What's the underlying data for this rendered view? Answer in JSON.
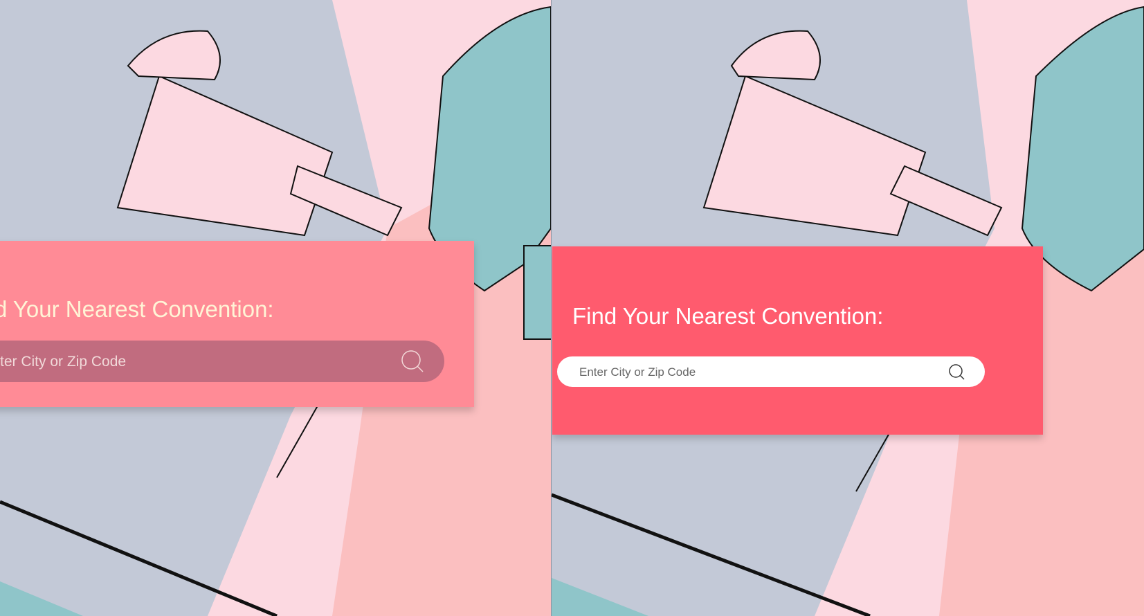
{
  "left_panel": {
    "title": "d Your Nearest Convention:",
    "search_placeholder": "ter City or Zip Code",
    "search_icon": "search-icon"
  },
  "right_panel": {
    "title": "Find Your Nearest Convention:",
    "search_placeholder": "Enter City or Zip Code",
    "search_icon": "search-icon"
  },
  "colors": {
    "left_card": "#ff8b96",
    "left_input": "#c16c7f",
    "right_card": "#ff5b6e",
    "right_input": "#ffffff",
    "background": "#c3c9d7"
  }
}
